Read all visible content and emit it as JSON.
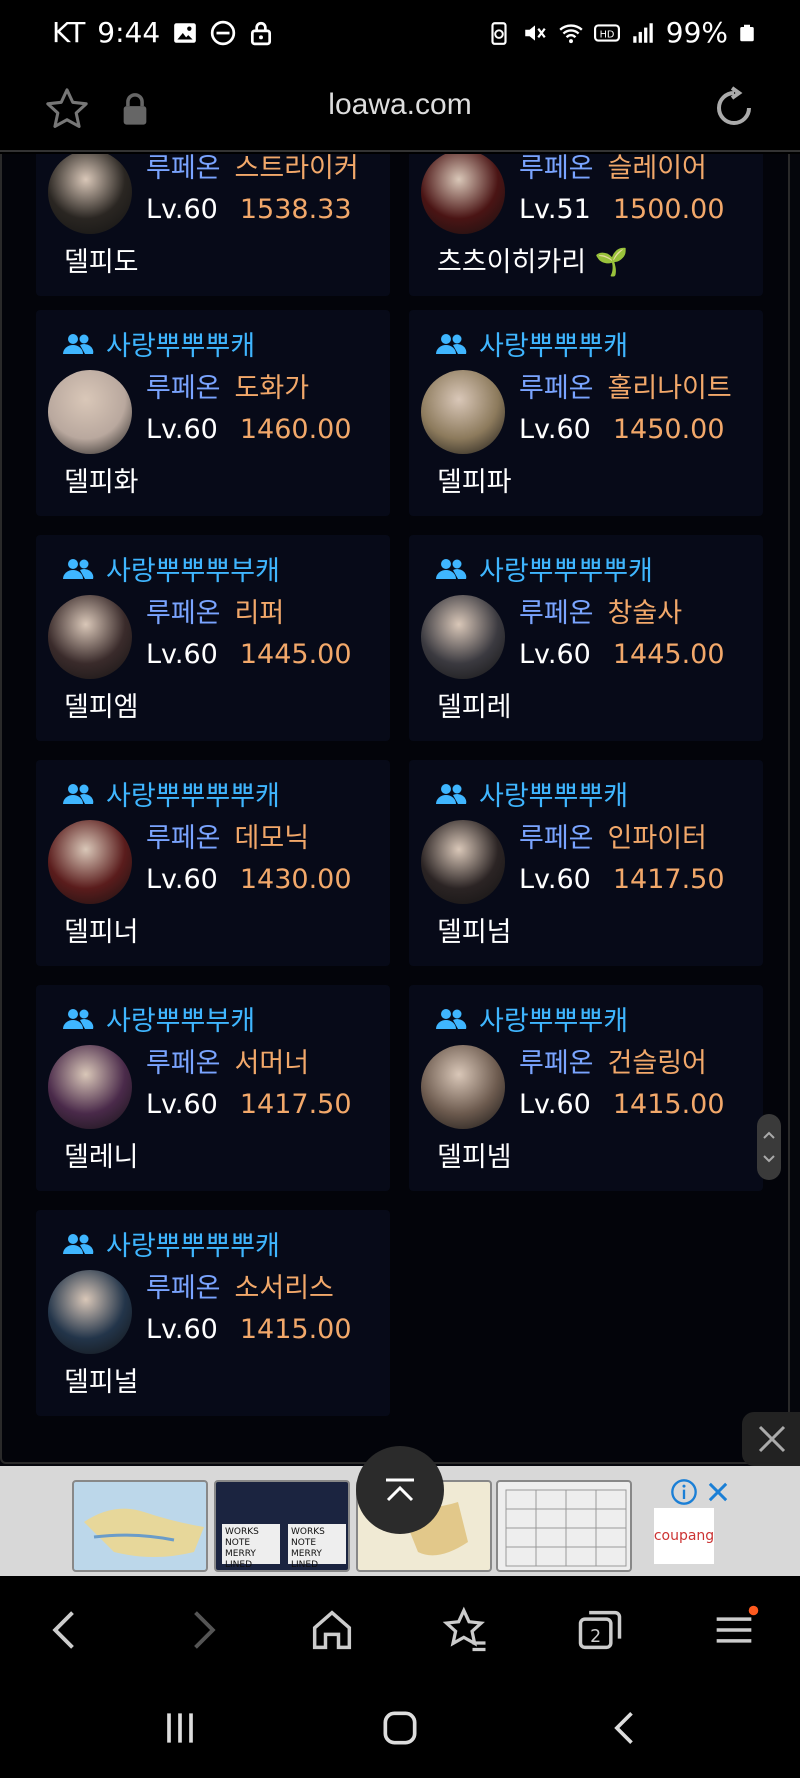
{
  "status_bar": {
    "carrier": "KT",
    "time": "9:44",
    "battery_text": "99%"
  },
  "browser": {
    "url": "loawa.com"
  },
  "cards": [
    {
      "guild": "",
      "server": "루페온",
      "class": "스트라이커",
      "level": "Lv.60",
      "item_level": "1538.33",
      "name": "델피도",
      "avatar_color": "#2a2622"
    },
    {
      "guild": "",
      "server": "루페온",
      "class": "슬레이어",
      "level": "Lv.51",
      "item_level": "1500.00",
      "name": "츠츠이히카리 🌱",
      "avatar_color": "#4a1414"
    },
    {
      "guild": "사랑뿌뿌뿌캐",
      "server": "루페온",
      "class": "도화가",
      "level": "Lv.60",
      "item_level": "1460.00",
      "name": "델피화",
      "avatar_color": "#b9a89e"
    },
    {
      "guild": "사랑뿌뿌뿌캐",
      "server": "루페온",
      "class": "홀리나이트",
      "level": "Lv.60",
      "item_level": "1450.00",
      "name": "델피파",
      "avatar_color": "#8c7a5c"
    },
    {
      "guild": "사랑뿌뿌뿌부캐",
      "server": "루페온",
      "class": "리퍼",
      "level": "Lv.60",
      "item_level": "1445.00",
      "name": "델피엠",
      "avatar_color": "#3a2b2b"
    },
    {
      "guild": "사랑뿌뿌뿌뿌캐",
      "server": "루페온",
      "class": "창술사",
      "level": "Lv.60",
      "item_level": "1445.00",
      "name": "델피레",
      "avatar_color": "#3b3a40"
    },
    {
      "guild": "사랑뿌뿌뿌뿌캐",
      "server": "루페온",
      "class": "데모닉",
      "level": "Lv.60",
      "item_level": "1430.00",
      "name": "델피너",
      "avatar_color": "#5a1c1c"
    },
    {
      "guild": "사랑뿌뿌뿌캐",
      "server": "루페온",
      "class": "인파이터",
      "level": "Lv.60",
      "item_level": "1417.50",
      "name": "델피넘",
      "avatar_color": "#2b2424"
    },
    {
      "guild": "사랑뿌뿌부캐",
      "server": "루페온",
      "class": "서머너",
      "level": "Lv.60",
      "item_level": "1417.50",
      "name": "델레니",
      "avatar_color": "#4a2a4a"
    },
    {
      "guild": "사랑뿌뿌뿌캐",
      "server": "루페온",
      "class": "건슬링어",
      "level": "Lv.60",
      "item_level": "1415.00",
      "name": "델피넴",
      "avatar_color": "#6c5a4e"
    },
    {
      "guild": "사랑뿌뿌뿌뿌캐",
      "server": "루페온",
      "class": "소서리스",
      "level": "Lv.60",
      "item_level": "1415.00",
      "name": "델피널",
      "avatar_color": "#23354a"
    }
  ],
  "ad": {
    "brand": "coupang",
    "thumb2_text": "WORKS NOTE MERRY LINED"
  },
  "colors": {
    "guild": "#3fb6ff",
    "server": "#7aa4ff",
    "class": "#f2a86a",
    "notification_dot": "#ff5a1f"
  }
}
